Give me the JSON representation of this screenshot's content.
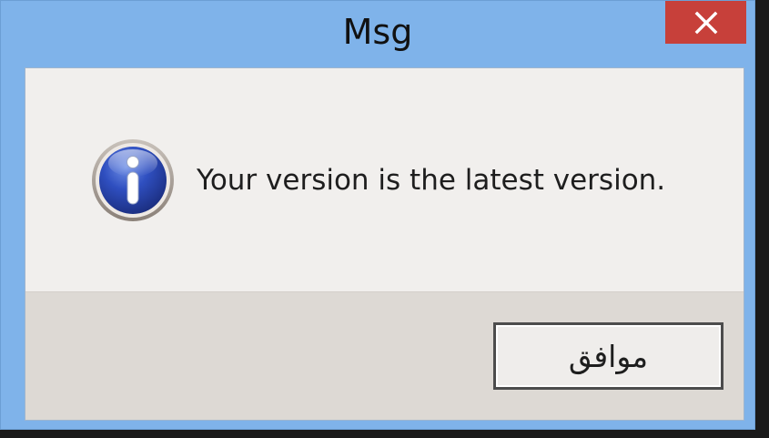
{
  "dialog": {
    "title": "Msg",
    "message": "Your version is the latest version.",
    "ok_label": "موافق",
    "icon": "info-icon",
    "close_icon": "close-icon"
  },
  "colors": {
    "titlebar": "#7fb3ea",
    "close_button": "#c7403a",
    "content_bg": "#f1efed",
    "button_area_bg": "#ddd9d4",
    "icon_blue": "#2a45a8"
  }
}
